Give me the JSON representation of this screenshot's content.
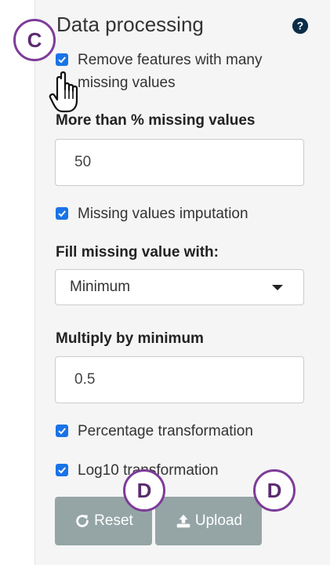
{
  "panel": {
    "title": "Data processing",
    "help_icon": "question-circle-icon"
  },
  "remove_features": {
    "checked": true,
    "label_line1": "Remove features with many",
    "label_line2": "missing values"
  },
  "missing_threshold": {
    "label": "More than % missing values",
    "value": "50"
  },
  "imputation": {
    "checked": true,
    "label": "Missing values imputation"
  },
  "fill_missing": {
    "label": "Fill missing value with:",
    "selected": "Minimum"
  },
  "multiply": {
    "label": "Multiply by minimum",
    "value": "0.5"
  },
  "percentage": {
    "checked": true,
    "label": "Percentage transformation"
  },
  "log10": {
    "checked": true,
    "label": "Log10 transformation"
  },
  "buttons": {
    "reset_label": "Reset",
    "reset_icon": "refresh-icon",
    "upload_label": "Upload",
    "upload_icon": "upload-icon"
  },
  "annotations": {
    "badge_c": "C",
    "badge_d1": "D",
    "badge_d2": "D",
    "badge_color": "#7d3c98"
  },
  "colors": {
    "checkbox": "#1a73e8",
    "button": "#95a5a6",
    "panel_bg": "#f5f5f5"
  }
}
